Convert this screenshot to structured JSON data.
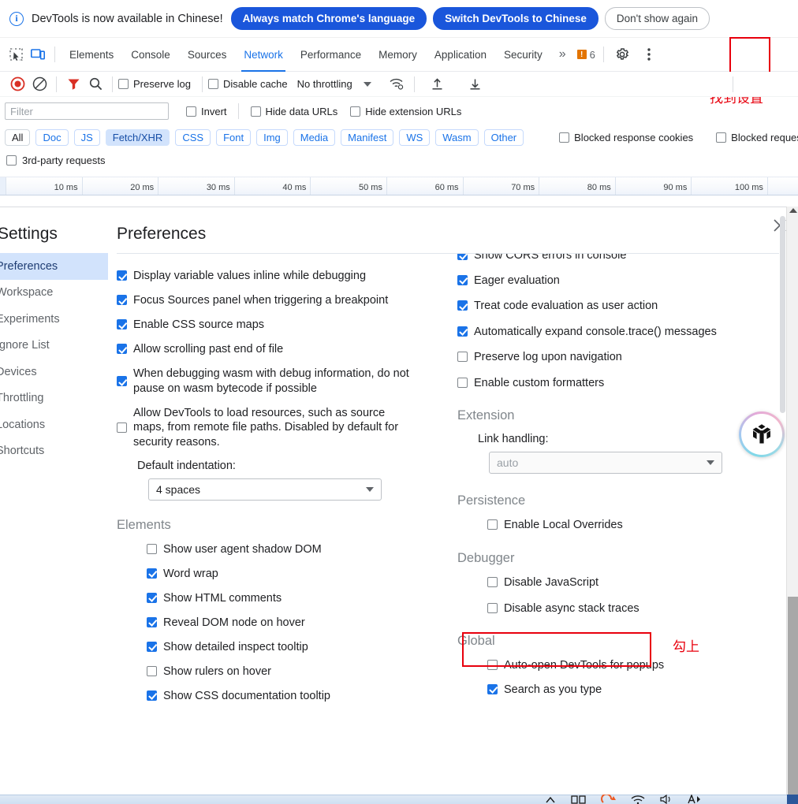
{
  "notification": {
    "icon": "info-icon",
    "message": "DevTools is now available in Chinese!",
    "primary_btn": "Always match Chrome's language",
    "secondary_btn": "Switch DevTools to Chinese",
    "dismiss_btn": "Don't show again"
  },
  "tabs": [
    {
      "label": "Elements",
      "active": false
    },
    {
      "label": "Console",
      "active": false
    },
    {
      "label": "Sources",
      "active": false
    },
    {
      "label": "Network",
      "active": true
    },
    {
      "label": "Performance",
      "active": false
    },
    {
      "label": "Memory",
      "active": false
    },
    {
      "label": "Application",
      "active": false
    },
    {
      "label": "Security",
      "active": false
    }
  ],
  "tabstrip": {
    "more_tabs": "»",
    "error_count": "6",
    "error_glyph": "!",
    "settings_icon": "gear-icon",
    "menu_icon": "kebab-menu-icon",
    "inspect_icon": "inspect-element-icon",
    "device_icon": "device-toolbar-icon"
  },
  "annotations": {
    "find_settings": "找到设置",
    "check_it": "勾上",
    "color": "#e8000d"
  },
  "network_toolbar": {
    "record_icon": "record-stop-icon",
    "clear_icon": "clear-network-icon",
    "filter_icon": "filter-funnel-icon",
    "search_icon": "search-icon",
    "preserve_log": {
      "label": "Preserve log",
      "checked": false
    },
    "disable_cache": {
      "label": "Disable cache",
      "checked": false
    },
    "throttling": "No throttling",
    "wifi_icon": "network-conditions-icon",
    "import_icon": "import-har-icon",
    "export_icon": "export-har-icon"
  },
  "filter_row": {
    "placeholder": "Filter",
    "value": "",
    "invert": {
      "label": "Invert",
      "checked": false
    },
    "hide_data_urls": {
      "label": "Hide data URLs",
      "checked": false
    },
    "hide_extension_urls": {
      "label": "Hide extension URLs",
      "checked": false
    }
  },
  "type_chips": [
    {
      "label": "All",
      "state": "plain"
    },
    {
      "label": "Doc",
      "state": "normal"
    },
    {
      "label": "JS",
      "state": "normal"
    },
    {
      "label": "Fetch/XHR",
      "state": "selected"
    },
    {
      "label": "CSS",
      "state": "normal"
    },
    {
      "label": "Font",
      "state": "normal"
    },
    {
      "label": "Img",
      "state": "normal"
    },
    {
      "label": "Media",
      "state": "normal"
    },
    {
      "label": "Manifest",
      "state": "normal"
    },
    {
      "label": "WS",
      "state": "normal"
    },
    {
      "label": "Wasm",
      "state": "normal"
    },
    {
      "label": "Other",
      "state": "normal"
    }
  ],
  "chip_row_checkboxes": [
    {
      "label": "Blocked response cookies",
      "checked": false
    },
    {
      "label": "Blocked request",
      "checked": false
    }
  ],
  "third_party": {
    "label": "3rd-party requests",
    "checked": false
  },
  "timeline": {
    "ticks": [
      "10 ms",
      "20 ms",
      "30 ms",
      "40 ms",
      "50 ms",
      "60 ms",
      "70 ms",
      "80 ms",
      "90 ms",
      "100 ms"
    ]
  },
  "settings": {
    "title": "Settings",
    "pane_title": "Preferences",
    "close_icon": "close-icon",
    "sidebar": [
      {
        "label": "Preferences",
        "active": true
      },
      {
        "label": "Workspace",
        "active": false
      },
      {
        "label": "Experiments",
        "active": false
      },
      {
        "label": "Ignore List",
        "active": false
      },
      {
        "label": "Devices",
        "active": false
      },
      {
        "label": "Throttling",
        "active": false
      },
      {
        "label": "Locations",
        "active": false
      },
      {
        "label": "Shortcuts",
        "active": false
      }
    ],
    "left_column": {
      "options": [
        {
          "label": "Display variable values inline while debugging",
          "checked": true
        },
        {
          "label": "Focus Sources panel when triggering a breakpoint",
          "checked": true
        },
        {
          "label": "Enable CSS source maps",
          "checked": true
        },
        {
          "label": "Allow scrolling past end of file",
          "checked": true
        },
        {
          "label": "When debugging wasm with debug information, do not pause on wasm bytecode if possible",
          "checked": true
        },
        {
          "label": "Allow DevTools to load resources, such as source maps, from remote file paths. Disabled by default for security reasons.",
          "checked": false
        }
      ],
      "indent_label": "Default indentation:",
      "indent_value": "4 spaces",
      "elements_group": "Elements",
      "elements_options": [
        {
          "label": "Show user agent shadow DOM",
          "checked": false
        },
        {
          "label": "Word wrap",
          "checked": true
        },
        {
          "label": "Show HTML comments",
          "checked": true
        },
        {
          "label": "Reveal DOM node on hover",
          "checked": true
        },
        {
          "label": "Show detailed inspect tooltip",
          "checked": true
        },
        {
          "label": "Show rulers on hover",
          "checked": false
        },
        {
          "label": "Show CSS documentation tooltip",
          "checked": true
        }
      ]
    },
    "right_column": {
      "cut_option": {
        "label": "Show CORS errors in console",
        "checked": true
      },
      "console_options": [
        {
          "label": "Eager evaluation",
          "checked": true
        },
        {
          "label": "Treat code evaluation as user action",
          "checked": true
        },
        {
          "label": "Automatically expand console.trace() messages",
          "checked": true
        },
        {
          "label": "Preserve log upon navigation",
          "checked": false
        },
        {
          "label": "Enable custom formatters",
          "checked": false
        }
      ],
      "extension_group": "Extension",
      "link_handling_label": "Link handling:",
      "link_handling_value": "auto",
      "persistence_group": "Persistence",
      "persistence_options": [
        {
          "label": "Enable Local Overrides",
          "checked": false
        }
      ],
      "debugger_group": "Debugger",
      "debugger_options": [
        {
          "label": "Disable JavaScript",
          "checked": false,
          "highlighted": true
        },
        {
          "label": "Disable async stack traces",
          "checked": false
        }
      ],
      "global_group": "Global",
      "global_options": [
        {
          "label": "Auto-open DevTools for popups",
          "checked": false
        },
        {
          "label": "Search as you type",
          "checked": true
        }
      ]
    }
  },
  "float_widget": {
    "icon": "tripod-logo-icon"
  },
  "taskbar": {
    "icons": [
      "chevron-up-icon",
      "task-view-icon",
      "sogou-icon",
      "wifi-icon",
      "volume-icon",
      "ime-icon"
    ]
  }
}
